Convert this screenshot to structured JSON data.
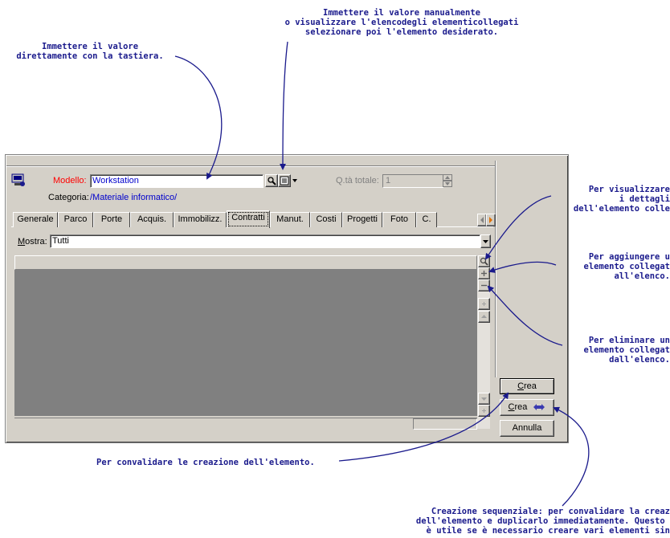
{
  "callouts": {
    "keyboard": "Immettere il valore\ndirettamente con la tastiera.",
    "list": "Immettere il valore manualmente\no visualizzare l'elencodegli elementicollegati\nselezionare poi l'elemento desiderato.",
    "details": "Per visualizzare\n i dettagli\ndell'elemento colle",
    "add": "Per aggiungere u\nelemento collegat\n all'elenco.",
    "remove": "Per eliminare un\nelemento collegat\n dall'elenco.",
    "create": "Per convalidare le creazione dell'elemento.",
    "sequential": "Creazione sequenziale: per convalidare la creaz\ndell'elemento e duplicarlo immediatamente. Questo \n è utile se è necessario creare vari elementi sin"
  },
  "form": {
    "model_label": "Modello:",
    "model_value": "Workstation",
    "qty_label": "Q.tà totale:",
    "qty_value": "1",
    "category_label": "Categoria:",
    "category_value": "/Materiale informatico/",
    "show_label_m": "M",
    "show_label_rest": "ostra:",
    "show_value": "Tutti"
  },
  "tabs": [
    "Generale",
    "Parco",
    "Porte",
    "Acquis.",
    "Immobilizz.",
    "Contratti",
    "Manut.",
    "Costi",
    "Progetti",
    "Foto",
    "C."
  ],
  "active_tab": "Contratti",
  "buttons": {
    "create_c": "C",
    "create_rest": "rea",
    "create_seq_c": "C",
    "create_seq_rest": "rea",
    "cancel": "Annulla"
  },
  "colors": {
    "callout_text": "#1a1a8c",
    "required_label": "#ff0000",
    "link_value": "#0000cc",
    "list_background": "#808080",
    "window_face": "#d4d0c8"
  },
  "icons": [
    "magnifier-icon",
    "list-icon",
    "dropdown-arrow-icon",
    "window-icon",
    "tab-prev-icon",
    "tab-next-icon",
    "zoom-icon",
    "plus-icon",
    "minus-icon",
    "spin-up-icon",
    "spin-down-icon",
    "duplicate-icon"
  ]
}
